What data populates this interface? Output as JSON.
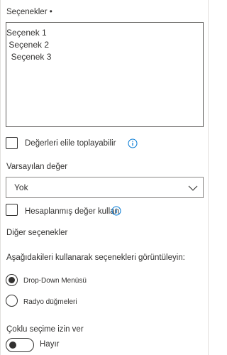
{
  "choices": {
    "label": "Seçenekler •",
    "lines": [
      "Seçenek 1",
      " Seçenek 2",
      "  Seçenek 3"
    ]
  },
  "fill_in": {
    "label": "Değerleri elile toplayabilir",
    "checked": false,
    "icon": "info-icon"
  },
  "default_value": {
    "label": "Varsayılan değer",
    "selected": "Yok",
    "icon": "chevron-down-icon"
  },
  "calculated": {
    "label": "Hesaplanmış değer kullan",
    "checked": false,
    "icon": "info-icon"
  },
  "other_options": {
    "heading": "Diğer seçenekler",
    "display_label": "Aşağıdakileri kullanarak seçenekleri görüntüleyin:",
    "display_options": [
      {
        "label": "Drop-Down Menüsü",
        "selected": true
      },
      {
        "label": "Radyo düğmeleri",
        "selected": false
      }
    ]
  },
  "multi_select": {
    "label": "Çoklu seçime izin ver",
    "toggle_label": "Hayır",
    "on": false
  },
  "colors": {
    "text": "#323130",
    "info_icon": "#0078d4",
    "border": "#605e5c"
  }
}
